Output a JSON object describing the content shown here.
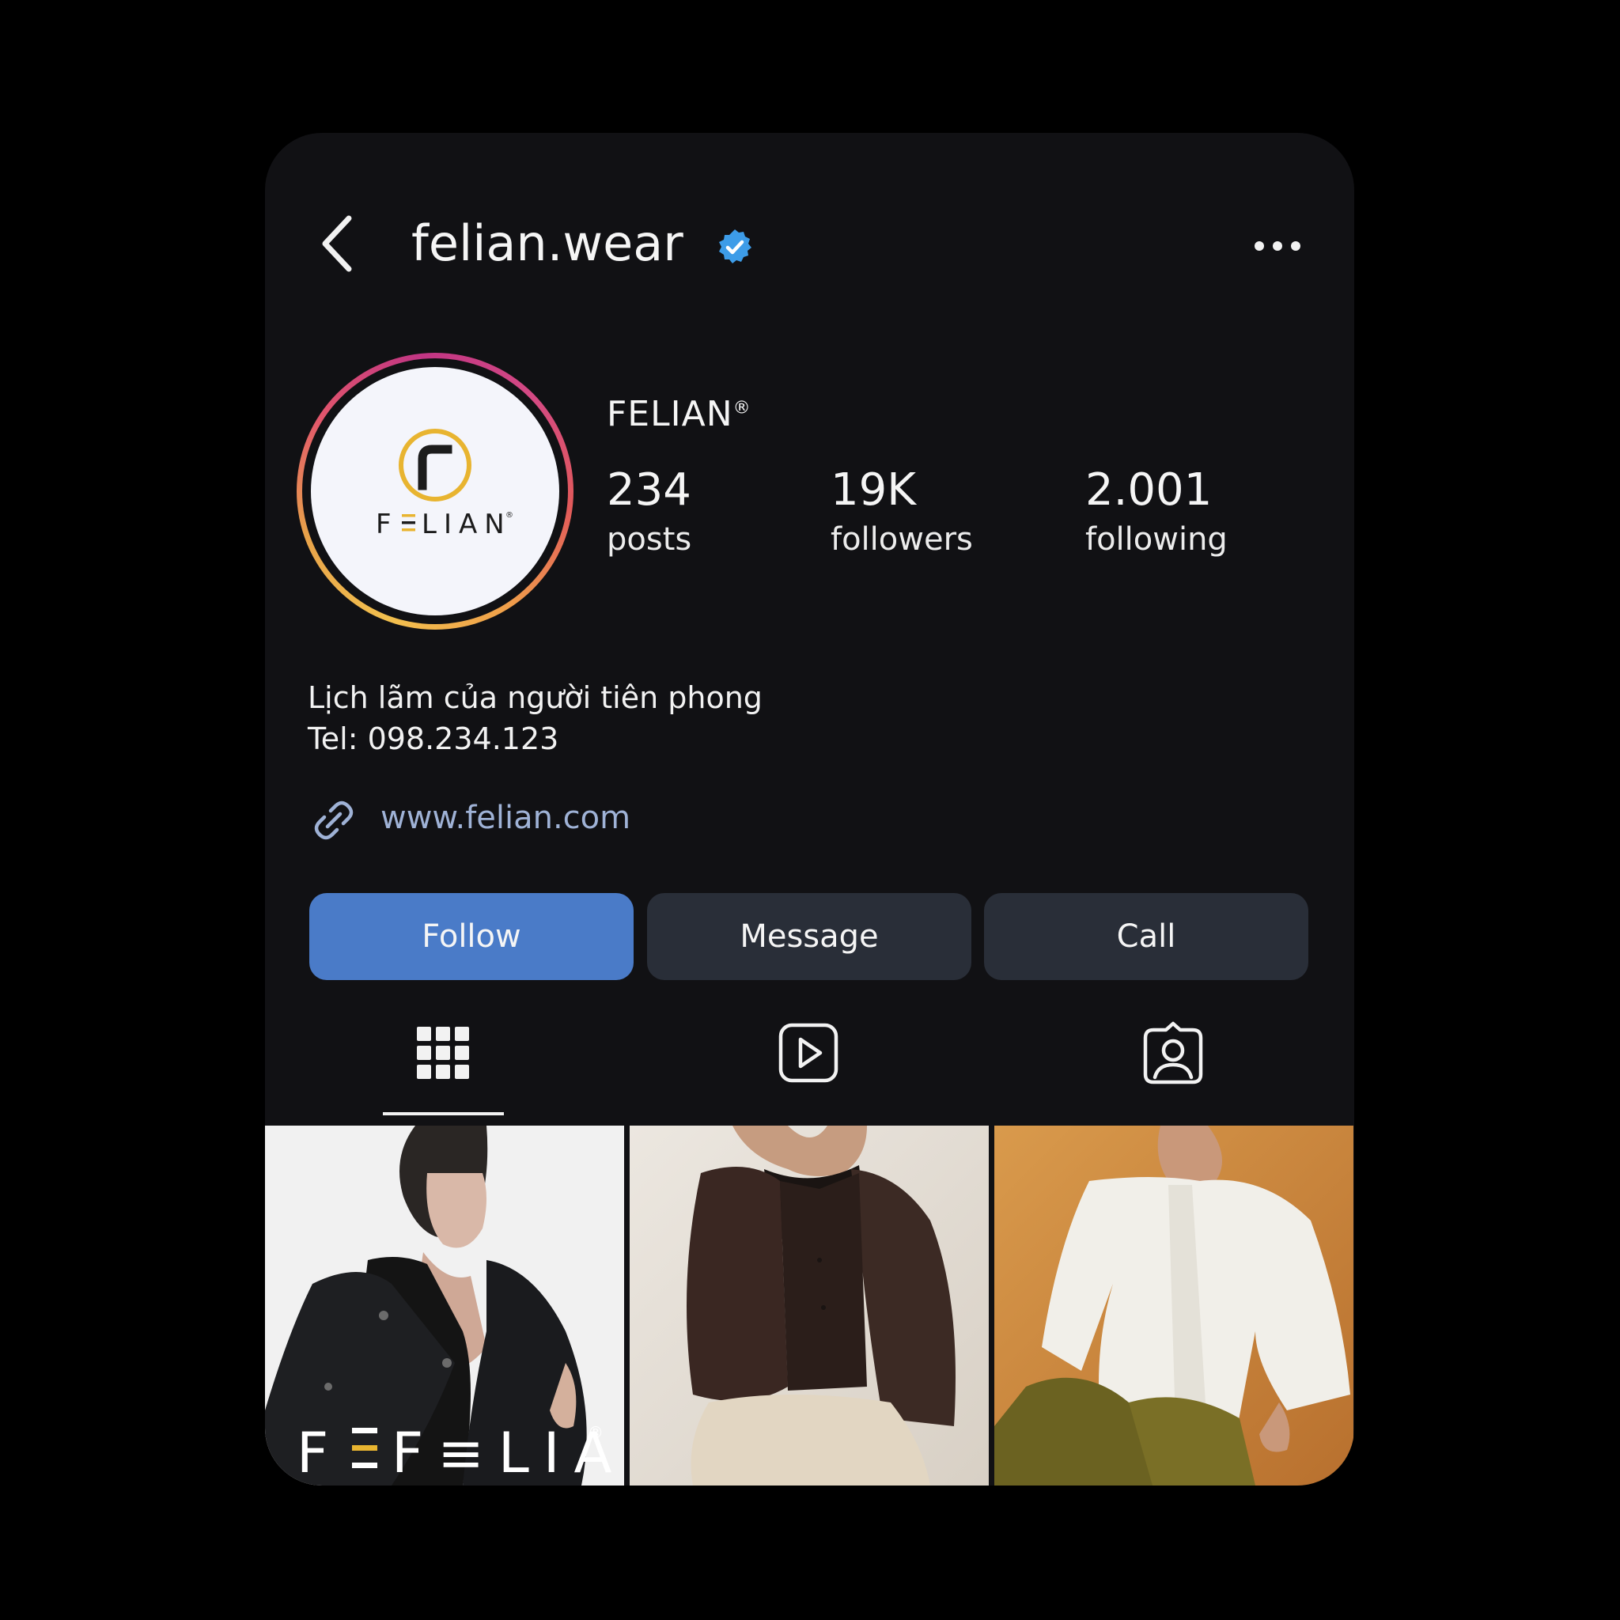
{
  "header": {
    "username": "felian.wear"
  },
  "profile": {
    "display_name": "FELIAN",
    "registered_mark": "®",
    "logo_text": "F≡LIAN",
    "stats": [
      {
        "value": "234",
        "label": "posts"
      },
      {
        "value": "19K",
        "label": "followers"
      },
      {
        "value": "2.001",
        "label": "following"
      }
    ],
    "bio_line1": "Lịch lãm của người tiên phong",
    "bio_line2": "Tel: 098.234.123",
    "website": "www.felian.com"
  },
  "actions": {
    "follow": "Follow",
    "message": "Message",
    "call": "Call"
  },
  "tabs": [
    {
      "icon": "grid-icon",
      "active": true
    },
    {
      "icon": "reels-icon",
      "active": false
    },
    {
      "icon": "tagged-icon",
      "active": false
    }
  ],
  "posts": [
    {
      "watermark": "F≡LIAN",
      "mark": "®"
    },
    {},
    {}
  ],
  "colors": {
    "background": "#000000",
    "card": "#111114",
    "follow_button": "#4a7bc8",
    "secondary_button": "#292e38",
    "link": "#9fb2d6",
    "verified": "#3d9ce8",
    "brand_gold": "#e8b430"
  }
}
